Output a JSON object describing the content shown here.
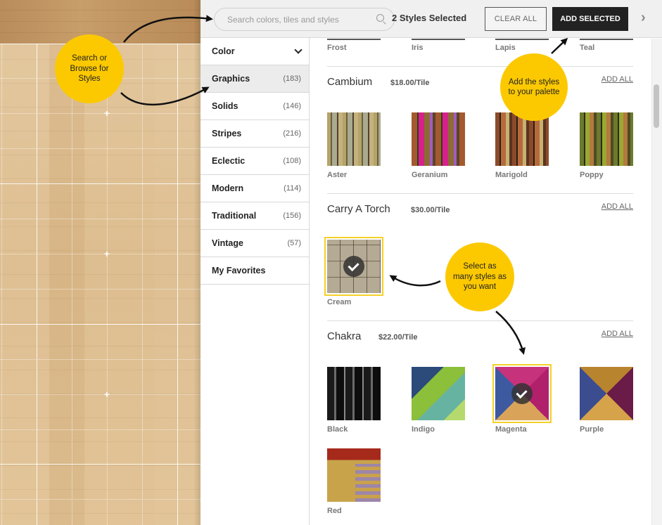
{
  "topbar": {
    "search_placeholder": "Search colors, tiles and styles",
    "search_value": "",
    "selected_count_text": "2 Styles Selected",
    "clear_all_label": "CLEAR ALL",
    "add_selected_label": "ADD SELECTED",
    "next_icon": "chevron-right-icon"
  },
  "sidebar": {
    "items": [
      {
        "label": "Color",
        "count": "",
        "type": "dropdown"
      },
      {
        "label": "Graphics",
        "count": "(183)",
        "active": true
      },
      {
        "label": "Solids",
        "count": "(146)"
      },
      {
        "label": "Stripes",
        "count": "(216)"
      },
      {
        "label": "Eclectic",
        "count": "(108)"
      },
      {
        "label": "Modern",
        "count": "(114)"
      },
      {
        "label": "Traditional",
        "count": "(156)"
      },
      {
        "label": "Vintage",
        "count": "(57)"
      },
      {
        "label": "My Favorites",
        "count": ""
      }
    ]
  },
  "main": {
    "partial_row": [
      "Frost",
      "Iris",
      "Lapis",
      "Teal"
    ],
    "sections": [
      {
        "name": "Cambium",
        "price": "$18.00/Tile",
        "add_all": "ADD ALL",
        "tiles": [
          {
            "label": "Aster",
            "selected": false
          },
          {
            "label": "Geranium",
            "selected": false
          },
          {
            "label": "Marigold",
            "selected": false
          },
          {
            "label": "Poppy",
            "selected": false
          }
        ]
      },
      {
        "name": "Carry A Torch",
        "price": "$30.00/Tile",
        "add_all": "ADD ALL",
        "tiles": [
          {
            "label": "Cream",
            "selected": true
          }
        ]
      },
      {
        "name": "Chakra",
        "price": "$22.00/Tile",
        "add_all": "ADD ALL",
        "tiles": [
          {
            "label": "Black",
            "selected": false
          },
          {
            "label": "Indigo",
            "selected": false
          },
          {
            "label": "Magenta",
            "selected": true
          },
          {
            "label": "Purple",
            "selected": false
          },
          {
            "label": "Red",
            "selected": false
          }
        ]
      }
    ]
  },
  "annotations": {
    "search_browse": "Search or Browse for Styles",
    "add_to_palette": "Add the styles to your palette",
    "select_many": "Select as many styles as you want"
  },
  "colors": {
    "accent_yellow": "#fcc900",
    "selected_outline": "#f5d027",
    "primary_button": "#222222"
  }
}
